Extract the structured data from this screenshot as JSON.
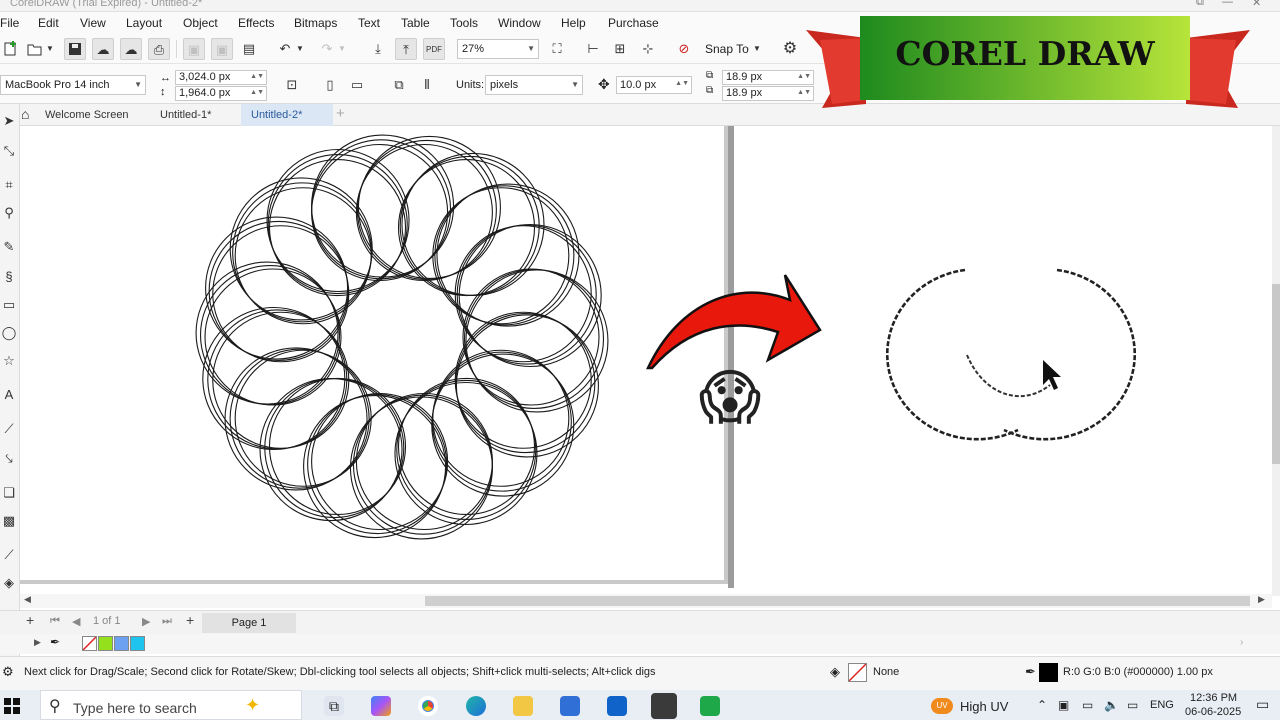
{
  "window": {
    "title": "CorelDRAW (Trial Expired) - Untitled-2*"
  },
  "menu": [
    "File",
    "Edit",
    "View",
    "Layout",
    "Object",
    "Effects",
    "Bitmaps",
    "Text",
    "Table",
    "Tools",
    "Window",
    "Help",
    "Purchase"
  ],
  "toolbar": {
    "zoom": "27%",
    "snap_label": "Snap To"
  },
  "property_bar": {
    "page_preset": "MacBook Pro 14 inch",
    "width": "3,024.0 px",
    "height": "1,964.0 px",
    "units_label": "Units:",
    "units_value": "pixels",
    "nudge": "10.0 px",
    "dup_x": "18.9 px",
    "dup_y": "18.9 px"
  },
  "tabs": [
    "Welcome Screen",
    "Untitled-1*",
    "Untitled-2*"
  ],
  "page_nav": {
    "pages": "1 of 1",
    "page_tab": "Page 1"
  },
  "palette": {
    "colors": [
      "#ffffff",
      "#94e01d",
      "#6ca0f0",
      "#1ec4ee"
    ]
  },
  "status": {
    "hint": "Next click for Drag/Scale; Second click for Rotate/Skew; Dbl-clicking tool selects all objects; Shift+click multi-selects; Alt+click digs",
    "fill": "None",
    "outline": "R:0 G:0 B:0 (#000000)  1.00 px"
  },
  "taskbar": {
    "search_placeholder": "Type here to search",
    "weather": "High UV",
    "lang": "ENG",
    "time": "12:36 PM",
    "date": "06-06-2025"
  },
  "overlay": {
    "banner_title": "COREL DRAW",
    "emoji": "😱"
  },
  "colors": {
    "banner_green_left": "#1e8a1e",
    "banner_green_right": "#b7e43a",
    "ribbon_red": "#d42a1e",
    "arrow_red": "#e8180c",
    "active_tab": "#dbe7f5"
  }
}
